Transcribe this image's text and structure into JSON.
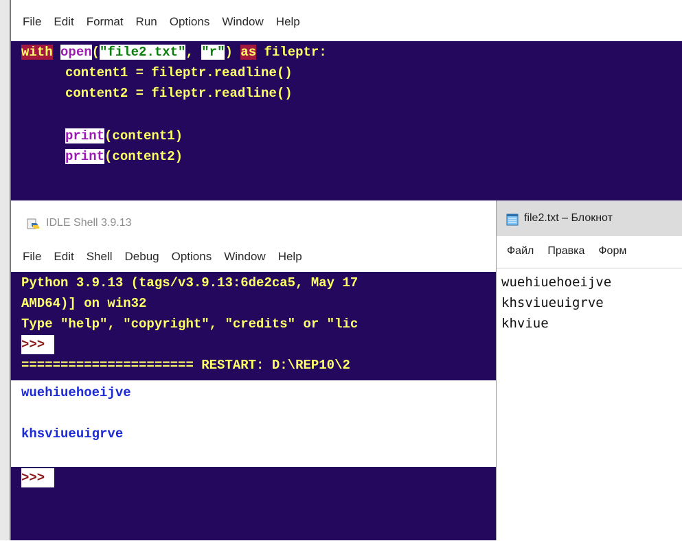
{
  "editor": {
    "menu": [
      "File",
      "Edit",
      "Format",
      "Run",
      "Options",
      "Window",
      "Help"
    ],
    "code": {
      "line1": {
        "kw_with": "with",
        "fn_open": "open",
        "paren_open": "(",
        "str_file": "\"file2.txt\"",
        "comma": ", ",
        "str_mode": "\"r\"",
        "paren_close": ")",
        "kw_as": "as",
        "rest": " fileptr:"
      },
      "line2": "content1 = fileptr.readline()",
      "line3": "content2 = fileptr.readline()",
      "line5": {
        "fn": "print",
        "args": "(content1)"
      },
      "line6": {
        "fn": "print",
        "args": "(content2)"
      }
    }
  },
  "shell": {
    "title": "IDLE Shell 3.9.13",
    "menu": [
      "File",
      "Edit",
      "Shell",
      "Debug",
      "Options",
      "Window",
      "Help"
    ],
    "banner1": "Python 3.9.13 (tags/v3.9.13:6de2ca5, May 17",
    "banner2": "AMD64)] on win32",
    "banner3": "Type \"help\", \"copyright\", \"credits\" or \"lic",
    "prompt1": ">>> ",
    "restart": "====================== RESTART: D:\\REP10\\2",
    "out1": "wuehiuehoeijve",
    "out2": "khsviueuigrve",
    "prompt2": ">>> "
  },
  "notepad": {
    "title": "file2.txt – Блокнот",
    "menu": [
      "Файл",
      "Правка",
      "Форм"
    ],
    "lines": [
      "wuehiuehoeijve",
      "khsviueuigrve",
      "khviue"
    ]
  },
  "colors": {
    "editor_bg": "#24085e",
    "shell_bg": "#24085e",
    "keyword_bg": "#a3183e",
    "text_yellow": "#ffff66",
    "builtin_purple": "#9b1cb3",
    "string_green": "#0b7f0b",
    "output_blue": "#1a2ad6",
    "prompt_red": "#8b1a1a"
  }
}
